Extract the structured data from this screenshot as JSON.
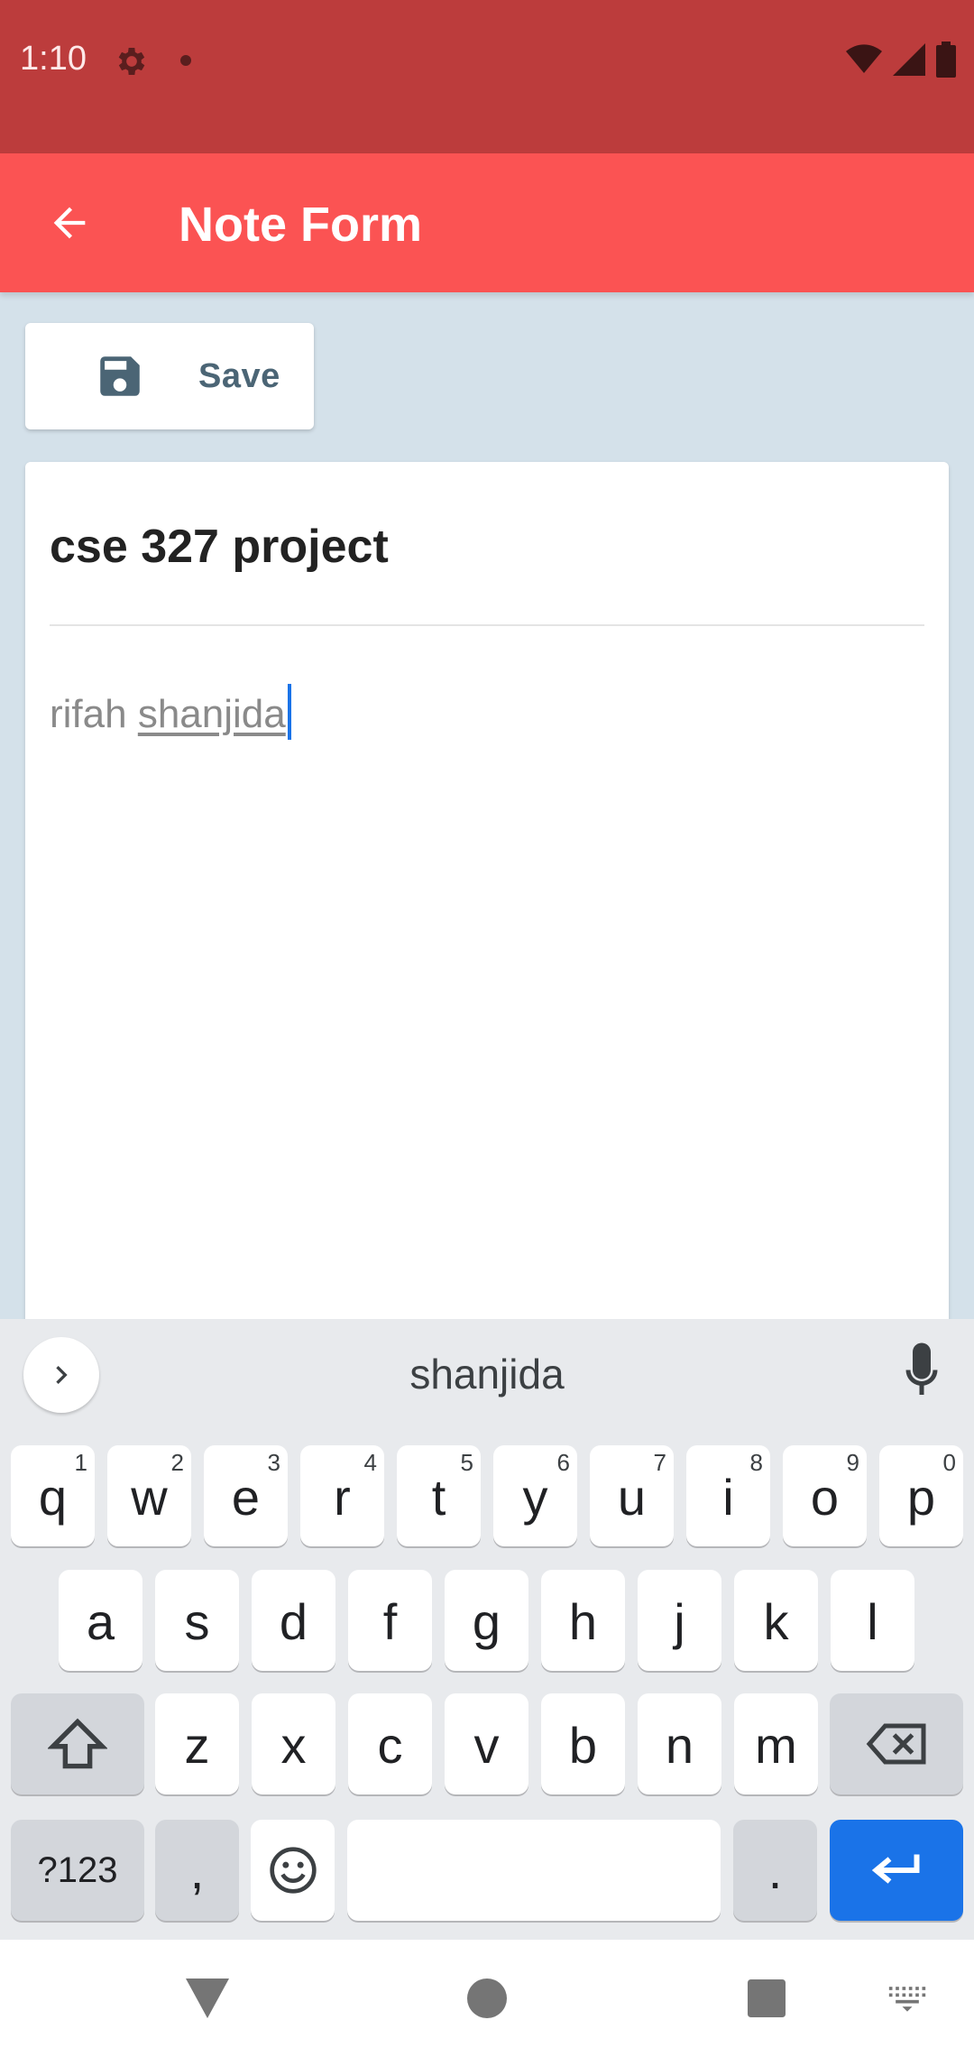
{
  "status_bar": {
    "time": "1:10",
    "icons": [
      "gear-icon",
      "notification-dot-icon",
      "wifi-icon",
      "signal-icon",
      "battery-icon"
    ],
    "color": "#bc3c3c"
  },
  "app_bar": {
    "title": "Note Form",
    "back_icon": "arrow-left-icon",
    "color": "#fb5353"
  },
  "toolbar": {
    "save_label": "Save",
    "save_icon": "floppy-disk-icon"
  },
  "note": {
    "title": "cse 327 project",
    "body_plain": "rifah ",
    "body_composing": "shanjida"
  },
  "keyboard": {
    "suggestion": "shanjida",
    "row1": [
      {
        "key": "q",
        "hint": "1"
      },
      {
        "key": "w",
        "hint": "2"
      },
      {
        "key": "e",
        "hint": "3"
      },
      {
        "key": "r",
        "hint": "4"
      },
      {
        "key": "t",
        "hint": "5"
      },
      {
        "key": "y",
        "hint": "6"
      },
      {
        "key": "u",
        "hint": "7"
      },
      {
        "key": "i",
        "hint": "8"
      },
      {
        "key": "o",
        "hint": "9"
      },
      {
        "key": "p",
        "hint": "0"
      }
    ],
    "row2": [
      "a",
      "s",
      "d",
      "f",
      "g",
      "h",
      "j",
      "k",
      "l"
    ],
    "row3": [
      "z",
      "x",
      "c",
      "v",
      "b",
      "n",
      "m"
    ],
    "symbols_label": "?123",
    "comma_label": ",",
    "period_label": ".",
    "enter_color": "#1a73e8"
  },
  "nav_bar": {
    "icons": [
      "back-triangle-icon",
      "home-circle-icon",
      "recents-square-icon",
      "keyboard-switch-icon"
    ]
  }
}
